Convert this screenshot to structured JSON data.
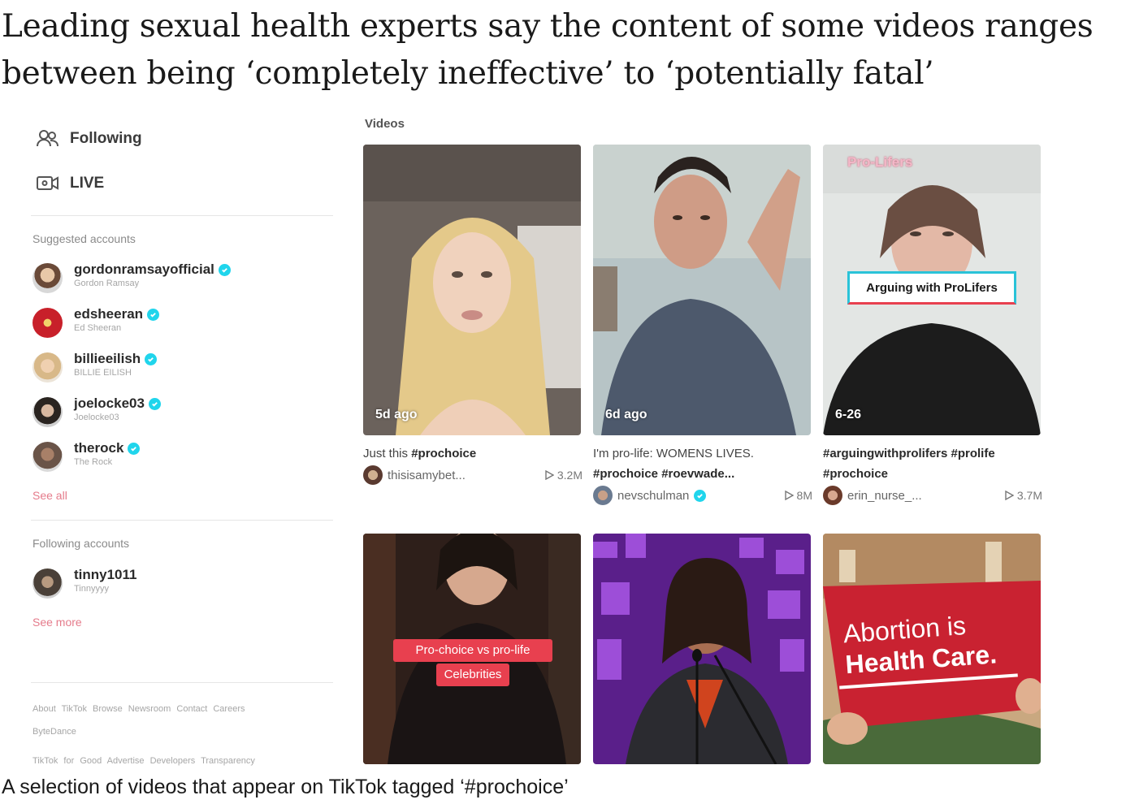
{
  "article": {
    "headline": "Leading sexual health experts say the content of some videos ranges between being ‘completely ineffective’ to ‘potentially fatal’",
    "caption": "A selection of videos that appear on TikTok tagged ‘#prochoice’"
  },
  "sidebar": {
    "nav": [
      {
        "label": "Following",
        "icon": "people-icon"
      },
      {
        "label": "LIVE",
        "icon": "live-camera-icon"
      }
    ],
    "suggested_title": "Suggested accounts",
    "suggested": [
      {
        "handle": "gordonramsayofficial",
        "name": "Gordon Ramsay",
        "verified": true
      },
      {
        "handle": "edsheeran",
        "name": "Ed Sheeran",
        "verified": true
      },
      {
        "handle": "billieeilish",
        "name": "BILLIE EILISH",
        "verified": true
      },
      {
        "handle": "joelocke03",
        "name": "Joelocke03",
        "verified": true
      },
      {
        "handle": "therock",
        "name": "The Rock",
        "verified": true
      }
    ],
    "see_all": "See all",
    "following_title": "Following accounts",
    "following": [
      {
        "handle": "tinny1011",
        "name": "Tinnyyyy"
      }
    ],
    "see_more": "See more",
    "footer": [
      "About  TikTok Browse  Newsroom  Contact  Careers",
      "ByteDance",
      "TikTok for Good  Advertise  Developers  Transparency"
    ]
  },
  "videos_label": "Videos",
  "videos": [
    {
      "date": "5d ago",
      "desc_plain": "Just this ",
      "desc_tags": "#prochoice",
      "desc_tags2": "",
      "author": "thisisamybet...",
      "author_verified": false,
      "views": "3.2M"
    },
    {
      "date": "6d ago",
      "desc_plain": "I'm pro-life: WOMENS LIVES.",
      "desc_tags": "",
      "desc_tags2": "#prochoice #roevwade...",
      "author": "nevschulman",
      "author_verified": true,
      "views": "8M"
    },
    {
      "date": "6-26",
      "overlay_top": "Pro-Lifers",
      "overlay": "Arguing with ProLifers",
      "desc_plain": "",
      "desc_tags": "#arguingwithprolifers #prolife",
      "desc_tags2": "#prochoice",
      "author": "erin_nurse_...",
      "author_verified": false,
      "views": "3.7M"
    },
    {
      "overlay_line1": "Pro-choice vs pro-life",
      "overlay_line2": "Celebrities"
    },
    {},
    {
      "sign_line1": "Abortion is",
      "sign_line2": "Health Care."
    }
  ],
  "colors": {
    "verified": "#20d5ec",
    "link": "#e57b8b",
    "tiktok_red": "#e8404f"
  }
}
